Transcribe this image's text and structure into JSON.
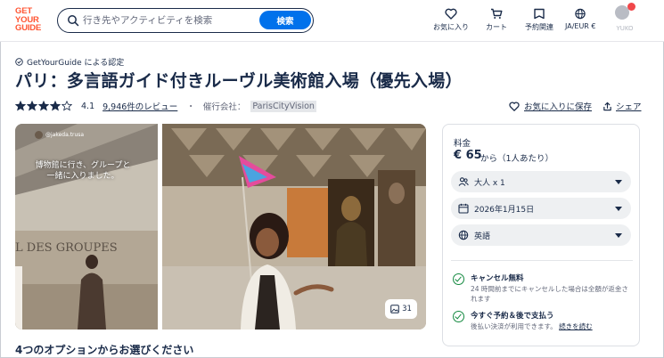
{
  "header": {
    "logo_lines": [
      "GET",
      "YOUR",
      "GUIDE"
    ],
    "search_placeholder": "行き先やアクティビティを検索",
    "search_button": "検索",
    "nav": [
      {
        "label": "お気に入り",
        "icon": "heart-icon"
      },
      {
        "label": "カート",
        "icon": "cart-icon"
      },
      {
        "label": "予約関連",
        "icon": "ticket-icon"
      },
      {
        "label": "JA/EUR €",
        "icon": "globe-icon"
      }
    ],
    "profile_label": "YUKO"
  },
  "product": {
    "certified": "GetYourGuide による認定",
    "title": "パリ：多言語ガイド付きルーヴル美術館入場（優先入場）",
    "rating": "4.1",
    "stars_filled": 4,
    "reviews": "9,946件のレビュー",
    "separator": "・",
    "organizer_label": "催行会社：",
    "organizer": "ParisCityVision",
    "wishlist": "お気に入りに保存",
    "share": "シェア"
  },
  "gallery": {
    "caption": "博物館に行き、グループと一緒に入りました。",
    "photo_user": "@jakeda.trusa",
    "photo_count": "31"
  },
  "booking": {
    "price_label": "料金",
    "price": "€ 65",
    "price_suffix": "から（1人あたり）",
    "participants": "大人 x 1",
    "date": "2026年1月15日",
    "language": "英語",
    "features": [
      {
        "title": "キャンセル無料",
        "desc": "24 時間前までにキャンセルした場合は全額が返金されます"
      },
      {
        "title": "今すぐ予約＆後で支払う",
        "desc": "後払い決済が利用できます。",
        "link": "続きを読む"
      }
    ]
  },
  "options_title": "4つのオプションからお選びください",
  "colors": {
    "brand": "#ff5533",
    "primary": "#0071eb",
    "text": "#1a2b49",
    "success": "#13893f"
  }
}
